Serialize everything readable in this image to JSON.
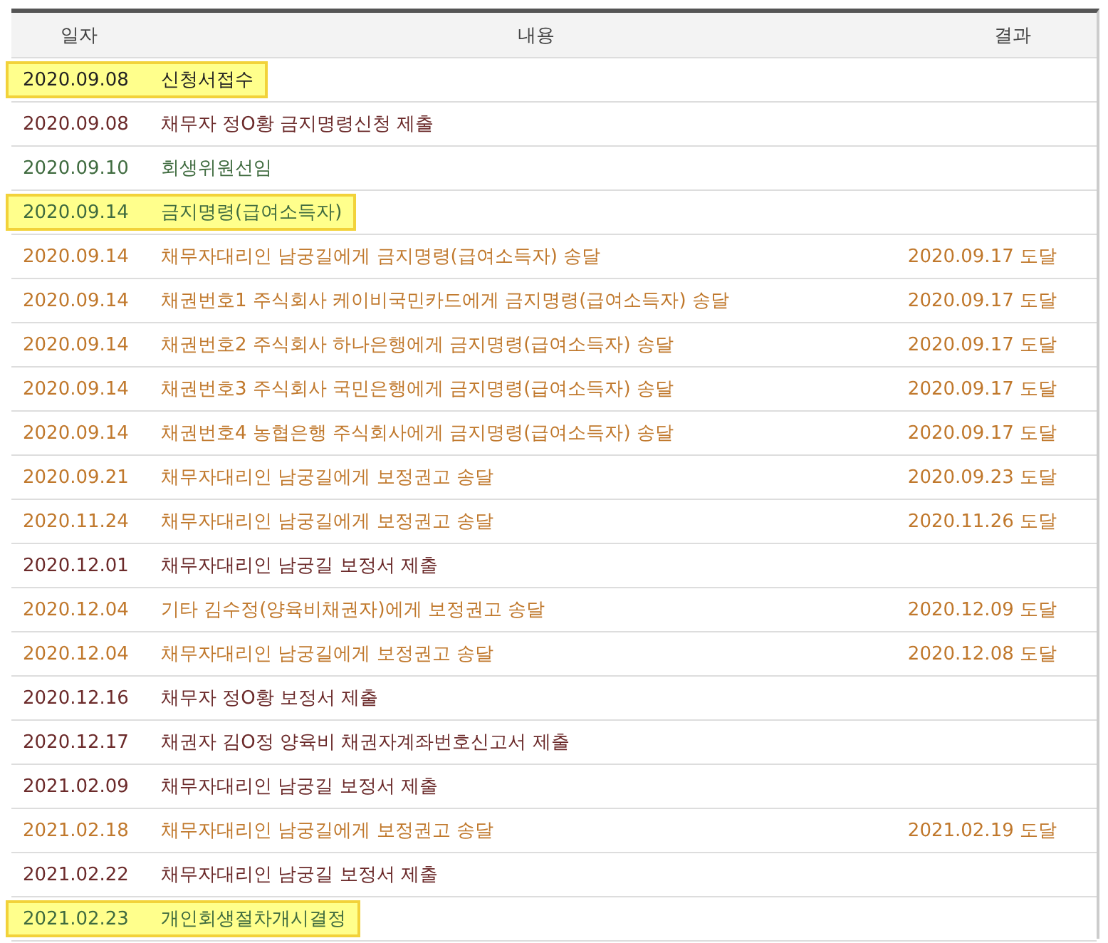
{
  "table": {
    "columns": [
      "일자",
      "내용",
      "결과"
    ],
    "rows": [
      {
        "date": "2020.09.08",
        "content": "신청서접수",
        "result": "",
        "kind": "basic",
        "highlighted": true
      },
      {
        "date": "2020.09.08",
        "content": "채무자 정O황 금지명령신청 제출",
        "result": "",
        "kind": "submission",
        "highlighted": false
      },
      {
        "date": "2020.09.10",
        "content": "회생위원선임",
        "result": "",
        "kind": "decision",
        "highlighted": false
      },
      {
        "date": "2020.09.14",
        "content": "금지명령(급여소득자)",
        "result": "",
        "kind": "decision",
        "highlighted": true
      },
      {
        "date": "2020.09.14",
        "content": "채무자대리인 남궁길에게 금지명령(급여소득자) 송달",
        "result": "2020.09.17 도달",
        "kind": "delivery",
        "highlighted": false
      },
      {
        "date": "2020.09.14",
        "content": "채권번호1 주식회사 케이비국민카드에게 금지명령(급여소득자) 송달",
        "result": "2020.09.17 도달",
        "kind": "delivery",
        "highlighted": false
      },
      {
        "date": "2020.09.14",
        "content": "채권번호2 주식회사 하나은행에게 금지명령(급여소득자) 송달",
        "result": "2020.09.17 도달",
        "kind": "delivery",
        "highlighted": false
      },
      {
        "date": "2020.09.14",
        "content": "채권번호3 주식회사 국민은행에게 금지명령(급여소득자) 송달",
        "result": "2020.09.17 도달",
        "kind": "delivery",
        "highlighted": false
      },
      {
        "date": "2020.09.14",
        "content": "채권번호4 농협은행 주식회사에게 금지명령(급여소득자) 송달",
        "result": "2020.09.17 도달",
        "kind": "delivery",
        "highlighted": false
      },
      {
        "date": "2020.09.21",
        "content": "채무자대리인 남궁길에게 보정권고 송달",
        "result": "2020.09.23 도달",
        "kind": "delivery",
        "highlighted": false
      },
      {
        "date": "2020.11.24",
        "content": "채무자대리인 남궁길에게 보정권고 송달",
        "result": "2020.11.26 도달",
        "kind": "delivery",
        "highlighted": false
      },
      {
        "date": "2020.12.01",
        "content": "채무자대리인 남궁길 보정서 제출",
        "result": "",
        "kind": "submission",
        "highlighted": false
      },
      {
        "date": "2020.12.04",
        "content": "기타 김수정(양육비채권자)에게 보정권고 송달",
        "result": "2020.12.09 도달",
        "kind": "delivery",
        "highlighted": false
      },
      {
        "date": "2020.12.04",
        "content": "채무자대리인 남궁길에게 보정권고 송달",
        "result": "2020.12.08 도달",
        "kind": "delivery",
        "highlighted": false
      },
      {
        "date": "2020.12.16",
        "content": "채무자 정O황 보정서 제출",
        "result": "",
        "kind": "submission",
        "highlighted": false
      },
      {
        "date": "2020.12.17",
        "content": "채권자 김O정 양육비 채권자계좌번호신고서 제출",
        "result": "",
        "kind": "submission",
        "highlighted": false
      },
      {
        "date": "2021.02.09",
        "content": "채무자대리인 남궁길 보정서 제출",
        "result": "",
        "kind": "submission",
        "highlighted": false
      },
      {
        "date": "2021.02.18",
        "content": "채무자대리인 남궁길에게 보정권고 송달",
        "result": "2021.02.19 도달",
        "kind": "delivery",
        "highlighted": false
      },
      {
        "date": "2021.02.22",
        "content": "채무자대리인 남궁길 보정서 제출",
        "result": "",
        "kind": "submission",
        "highlighted": false
      },
      {
        "date": "2021.02.23",
        "content": "개인회생절차개시결정",
        "result": "",
        "kind": "decision",
        "highlighted": true
      }
    ]
  }
}
